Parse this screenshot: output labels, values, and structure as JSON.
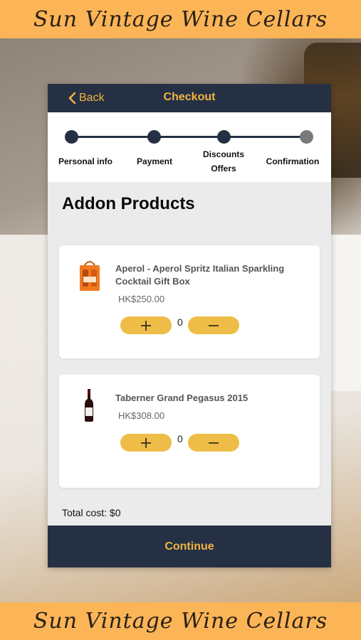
{
  "banner": {
    "top_text": "Sun Vintage Wine Cellars",
    "bottom_text": "Sun Vintage Wine Cellars"
  },
  "nav": {
    "back_label": "Back",
    "title": "Checkout"
  },
  "steps": [
    {
      "label": "Personal info",
      "state": "done"
    },
    {
      "label": "Payment",
      "state": "done"
    },
    {
      "label": "Discounts",
      "label2": "Offers",
      "state": "current"
    },
    {
      "label": "Confirmation",
      "state": "pending"
    }
  ],
  "section_title": "Addon Products",
  "products": [
    {
      "name": "Aperol - Aperol Spritz Italian Sparkling Cocktail Gift Box",
      "price": "HK$250.00",
      "quantity": "0",
      "image": "aperol-gift-box-image"
    },
    {
      "name": "Taberner Grand Pegasus 2015",
      "price": "HK$308.00",
      "quantity": "0",
      "image": "wine-bottle-image"
    }
  ],
  "total_label": "Total cost: $0",
  "continue_label": "Continue",
  "colors": {
    "navy": "#253044",
    "gold": "#f0b540",
    "button_gold": "#eebd47",
    "banner": "#fbb557"
  }
}
